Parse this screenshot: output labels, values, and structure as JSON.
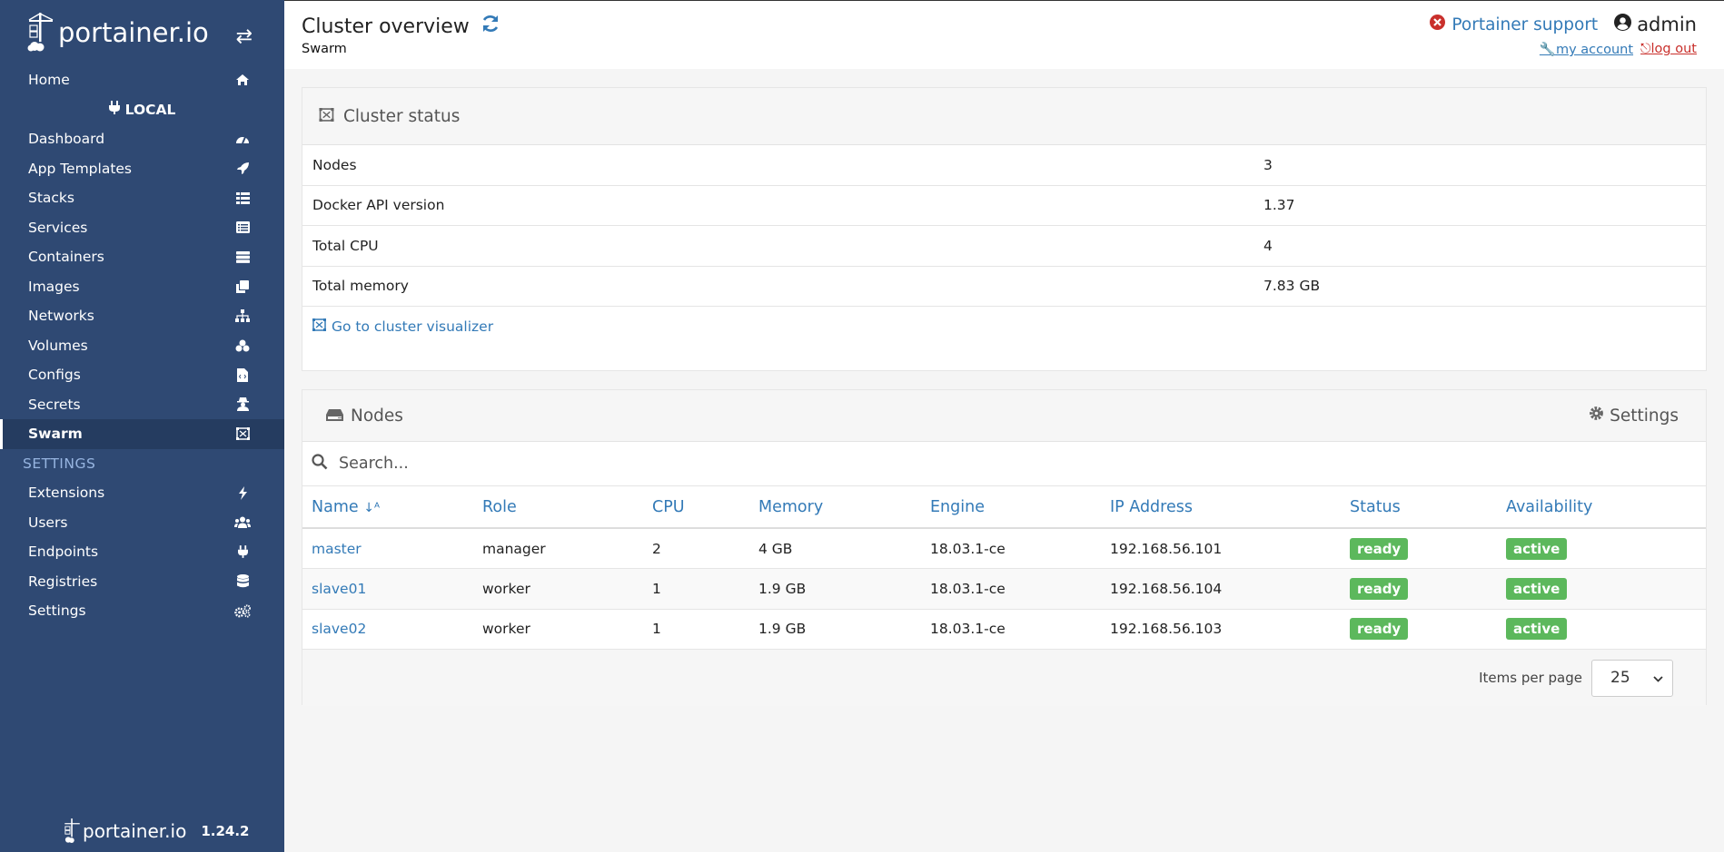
{
  "brand": {
    "name": "portainer.io",
    "version": "1.24.2"
  },
  "sidebar": {
    "home": "Home",
    "endpoint": "LOCAL",
    "items": [
      {
        "label": "Dashboard",
        "icon": "tachometer-icon"
      },
      {
        "label": "App Templates",
        "icon": "rocket-icon"
      },
      {
        "label": "Stacks",
        "icon": "th-list-icon"
      },
      {
        "label": "Services",
        "icon": "list-alt-icon"
      },
      {
        "label": "Containers",
        "icon": "server-icon"
      },
      {
        "label": "Images",
        "icon": "clone-icon"
      },
      {
        "label": "Networks",
        "icon": "sitemap-icon"
      },
      {
        "label": "Volumes",
        "icon": "cubes-icon"
      },
      {
        "label": "Configs",
        "icon": "file-code-icon"
      },
      {
        "label": "Secrets",
        "icon": "user-secret-icon"
      },
      {
        "label": "Swarm",
        "icon": "object-group-icon",
        "active": true
      }
    ],
    "settings_heading": "SETTINGS",
    "settings_items": [
      {
        "label": "Extensions",
        "icon": "bolt-icon"
      },
      {
        "label": "Users",
        "icon": "users-icon"
      },
      {
        "label": "Endpoints",
        "icon": "plug-icon"
      },
      {
        "label": "Registries",
        "icon": "database-icon"
      },
      {
        "label": "Settings",
        "icon": "cogs-icon"
      }
    ]
  },
  "header": {
    "title": "Cluster overview",
    "subtitle": "Swarm",
    "support": "Portainer support",
    "user": "admin",
    "my_account": "my account",
    "log_out": "log out"
  },
  "cluster_status": {
    "title": "Cluster status",
    "rows": [
      {
        "key": "Nodes",
        "value": "3"
      },
      {
        "key": "Docker API version",
        "value": "1.37"
      },
      {
        "key": "Total CPU",
        "value": "4"
      },
      {
        "key": "Total memory",
        "value": "7.83 GB"
      }
    ],
    "visualizer_link": "Go to cluster visualizer"
  },
  "nodes": {
    "title": "Nodes",
    "settings": "Settings",
    "search_placeholder": "Search...",
    "columns": [
      "Name",
      "Role",
      "CPU",
      "Memory",
      "Engine",
      "IP Address",
      "Status",
      "Availability"
    ],
    "rows": [
      {
        "name": "master",
        "role": "manager",
        "cpu": "2",
        "memory": "4 GB",
        "engine": "18.03.1-ce",
        "ip": "192.168.56.101",
        "status": "ready",
        "availability": "active"
      },
      {
        "name": "slave01",
        "role": "worker",
        "cpu": "1",
        "memory": "1.9 GB",
        "engine": "18.03.1-ce",
        "ip": "192.168.56.104",
        "status": "ready",
        "availability": "active"
      },
      {
        "name": "slave02",
        "role": "worker",
        "cpu": "1",
        "memory": "1.9 GB",
        "engine": "18.03.1-ce",
        "ip": "192.168.56.103",
        "status": "ready",
        "availability": "active"
      }
    ],
    "items_per_page_label": "Items per page",
    "items_per_page": "25"
  },
  "colors": {
    "sidebar": "#2f4973",
    "link": "#337ab7",
    "badge": "#5cb85c",
    "logout": "#c9302c"
  }
}
